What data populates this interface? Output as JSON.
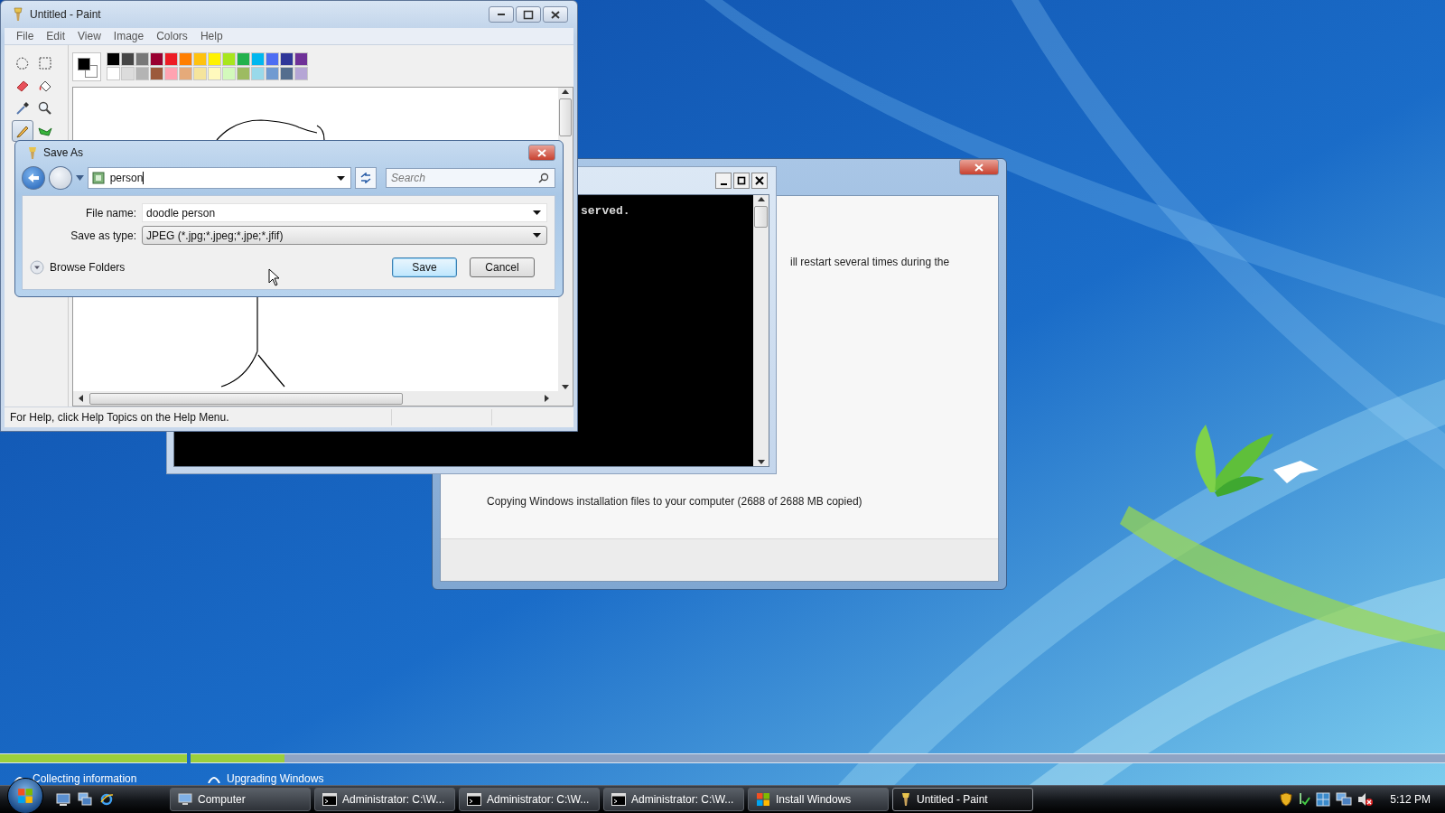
{
  "installer": {
    "note": "ill restart several times during the",
    "status": "Copying Windows installation files to your computer (2688 of 2688 MB copied)"
  },
  "console": {
    "text": "served."
  },
  "paint": {
    "title": "Untitled - Paint",
    "menu": [
      "File",
      "Edit",
      "View",
      "Image",
      "Colors",
      "Help"
    ],
    "tools": [
      {
        "kind": "free-select",
        "selected": false
      },
      {
        "kind": "rect-select",
        "selected": false
      },
      {
        "kind": "eraser",
        "selected": false
      },
      {
        "kind": "fill",
        "selected": false
      },
      {
        "kind": "picker",
        "selected": false
      },
      {
        "kind": "magnifier",
        "selected": false
      },
      {
        "kind": "pencil",
        "selected": true
      },
      {
        "kind": "brush",
        "selected": false
      }
    ],
    "current_colors": [
      {
        "color": "#000000"
      },
      {
        "color": "#ffffff"
      }
    ],
    "palette": [
      {
        "color": "#000000"
      },
      {
        "color": "#464646"
      },
      {
        "color": "#787878"
      },
      {
        "color": "#990030"
      },
      {
        "color": "#ed1c24"
      },
      {
        "color": "#ff7e00"
      },
      {
        "color": "#ffc20e"
      },
      {
        "color": "#fff200"
      },
      {
        "color": "#a8e61d"
      },
      {
        "color": "#22b14c"
      },
      {
        "color": "#00b7ef"
      },
      {
        "color": "#4d6df3"
      },
      {
        "color": "#2f3699"
      },
      {
        "color": "#6f3198"
      },
      {
        "color": "#ffffff"
      },
      {
        "color": "#dcdcdc"
      },
      {
        "color": "#b4b4b4"
      },
      {
        "color": "#9c5a3c"
      },
      {
        "color": "#ffa3b1"
      },
      {
        "color": "#e5aa7a"
      },
      {
        "color": "#f5e49c"
      },
      {
        "color": "#fff9bd"
      },
      {
        "color": "#d3f9bc"
      },
      {
        "color": "#9dbb61"
      },
      {
        "color": "#99d9ea"
      },
      {
        "color": "#709ad1"
      },
      {
        "color": "#546d8e"
      },
      {
        "color": "#b5a5d5"
      }
    ],
    "status": "For Help, click Help Topics on the Help Menu."
  },
  "save_dialog": {
    "title": "Save As",
    "address": "person",
    "search": {
      "placeholder": "Search"
    },
    "fields": [
      {
        "label": "File name:",
        "value": "doodle person",
        "kind": "combo"
      },
      {
        "label": "Save as type:",
        "value": "JPEG (*.jpg;*.jpeg;*.jpe;*.jfif)",
        "kind": "select"
      }
    ],
    "browse": "Browse Folders",
    "buttons": [
      {
        "label": "Save",
        "default": true
      },
      {
        "label": "Cancel",
        "default": false
      }
    ]
  },
  "setup_progress": {
    "steps": [
      {
        "label": "Collecting information",
        "level": 1
      },
      {
        "label": "Upgrading Windows",
        "level": 0.075
      }
    ]
  },
  "taskbar": {
    "items": [
      {
        "label": "Computer",
        "kind": "computer",
        "selected": false
      },
      {
        "label": "Administrator: C:\\W...",
        "kind": "console",
        "selected": false
      },
      {
        "label": "Administrator: C:\\W...",
        "kind": "console",
        "selected": false
      },
      {
        "label": "Administrator: C:\\W...",
        "kind": "console",
        "selected": false
      },
      {
        "label": "Install Windows",
        "kind": "setup",
        "selected": false
      },
      {
        "label": "Untitled - Paint",
        "kind": "paint",
        "selected": true
      }
    ],
    "clock": "5:12 PM"
  }
}
